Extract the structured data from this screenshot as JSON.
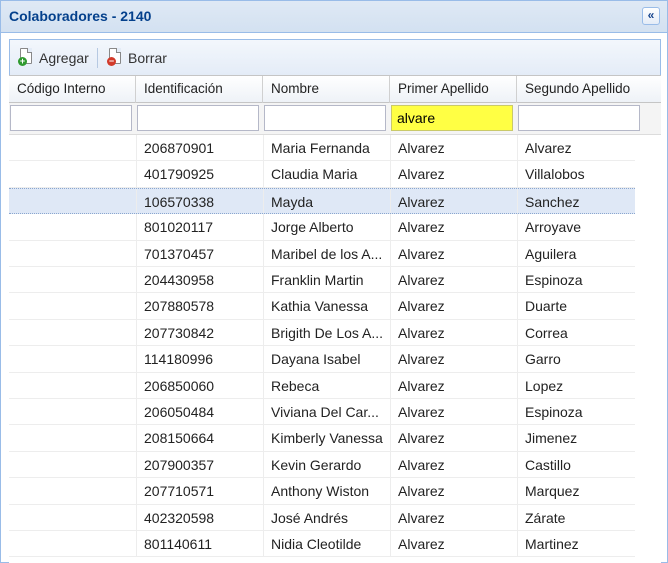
{
  "panel": {
    "title": "Colaboradores - 2140",
    "collapse_glyph": "«"
  },
  "toolbar": {
    "add_label": "Agregar",
    "delete_label": "Borrar",
    "add_icon": "add-document-icon",
    "delete_icon": "delete-document-icon"
  },
  "columns": [
    "Código Interno",
    "Identificación",
    "Nombre",
    "Primer Apellido",
    "Segundo Apellido"
  ],
  "filters": {
    "codigo": "",
    "identificacion": "",
    "nombre": "",
    "primer_apellido": "alvare",
    "segundo_apellido": ""
  },
  "colors": {
    "filter_highlight": "#ffff44",
    "selected_row": "#dfe8f6",
    "title": "#04408c"
  },
  "selected_row_index": 2,
  "rows": [
    {
      "codigo": "",
      "identificacion": "206870901",
      "nombre": "Maria Fernanda",
      "primer_apellido": "Alvarez",
      "segundo_apellido": "Alvarez"
    },
    {
      "codigo": "",
      "identificacion": "401790925",
      "nombre": "Claudia Maria",
      "primer_apellido": "Alvarez",
      "segundo_apellido": "Villalobos"
    },
    {
      "codigo": "",
      "identificacion": "106570338",
      "nombre": "Mayda",
      "primer_apellido": "Alvarez",
      "segundo_apellido": "Sanchez"
    },
    {
      "codigo": "",
      "identificacion": "801020117",
      "nombre": "Jorge Alberto",
      "primer_apellido": "Alvarez",
      "segundo_apellido": "Arroyave"
    },
    {
      "codigo": "",
      "identificacion": "701370457",
      "nombre": "Maribel de los A...",
      "primer_apellido": "Alvarez",
      "segundo_apellido": "Aguilera"
    },
    {
      "codigo": "",
      "identificacion": "204430958",
      "nombre": "Franklin Martin",
      "primer_apellido": "Alvarez",
      "segundo_apellido": "Espinoza"
    },
    {
      "codigo": "",
      "identificacion": "207880578",
      "nombre": "Kathia Vanessa",
      "primer_apellido": "Alvarez",
      "segundo_apellido": "Duarte"
    },
    {
      "codigo": "",
      "identificacion": "207730842",
      "nombre": "Brigith De Los A...",
      "primer_apellido": "Alvarez",
      "segundo_apellido": "Correa"
    },
    {
      "codigo": "",
      "identificacion": "114180996",
      "nombre": "Dayana Isabel",
      "primer_apellido": "Alvarez",
      "segundo_apellido": "Garro"
    },
    {
      "codigo": "",
      "identificacion": "206850060",
      "nombre": "Rebeca",
      "primer_apellido": "Alvarez",
      "segundo_apellido": "Lopez"
    },
    {
      "codigo": "",
      "identificacion": "206050484",
      "nombre": "Viviana Del Car...",
      "primer_apellido": "Alvarez",
      "segundo_apellido": "Espinoza"
    },
    {
      "codigo": "",
      "identificacion": "208150664",
      "nombre": "Kimberly Vanessa",
      "primer_apellido": "Alvarez",
      "segundo_apellido": "Jimenez"
    },
    {
      "codigo": "",
      "identificacion": "207900357",
      "nombre": "Kevin Gerardo",
      "primer_apellido": "Alvarez",
      "segundo_apellido": "Castillo"
    },
    {
      "codigo": "",
      "identificacion": "207710571",
      "nombre": "Anthony Wiston",
      "primer_apellido": "Alvarez",
      "segundo_apellido": "Marquez"
    },
    {
      "codigo": "",
      "identificacion": "402320598",
      "nombre": "José Andrés",
      "primer_apellido": "Alvarez",
      "segundo_apellido": "Zárate"
    },
    {
      "codigo": "",
      "identificacion": "801140611",
      "nombre": "Nidia Cleotilde",
      "primer_apellido": "Alvarez",
      "segundo_apellido": "Martinez"
    }
  ]
}
